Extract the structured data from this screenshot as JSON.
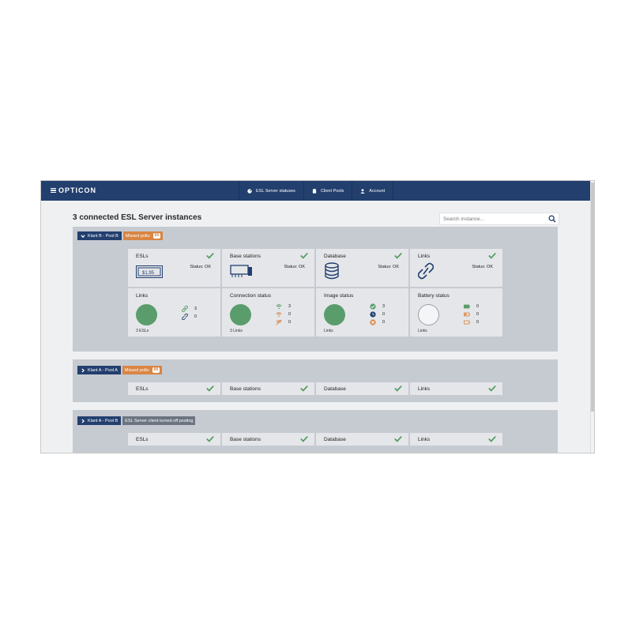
{
  "app": {
    "brand": "OPTICON",
    "nav": [
      {
        "label": "ESL Server statuses",
        "icon": "dashboard-icon"
      },
      {
        "label": "Client Pools",
        "icon": "clipboard-icon"
      },
      {
        "label": "Account",
        "icon": "user-icon"
      }
    ]
  },
  "page": {
    "title": "3 connected ESL Server instances",
    "search_placeholder": "Search instance..."
  },
  "colors": {
    "navy": "#223f6e",
    "orange": "#d98544",
    "green": "#5a9c6b",
    "check": "#4e9a5d",
    "panel": "#c6cad1"
  },
  "instances": [
    {
      "pool": "Klant B - Pool B",
      "badge_label": "Missed polls:",
      "badge_count": "89",
      "expanded": true,
      "cards": [
        {
          "title": "ESLs",
          "status": "Status: OK"
        },
        {
          "title": "Base stations",
          "status": "Status: OK"
        },
        {
          "title": "Database",
          "status": "Status: OK"
        },
        {
          "title": "Links",
          "status": "Status: OK"
        }
      ],
      "details": [
        {
          "title": "Links",
          "stats": [
            "3",
            "0"
          ],
          "footer": "3 ESLs"
        },
        {
          "title": "Connection status",
          "stats": [
            "3",
            "0",
            "0"
          ],
          "footer": "3 Links"
        },
        {
          "title": "Image status",
          "stats": [
            "3",
            "0",
            "0"
          ],
          "footer": "Links"
        },
        {
          "title": "Battery status",
          "stats": [
            "0",
            "0",
            "0"
          ],
          "footer": "Links"
        }
      ]
    },
    {
      "pool": "Klant A - Pool A",
      "badge_label": "Missed polls:",
      "badge_count": "89",
      "expanded": false,
      "cards": [
        {
          "title": "ESLs"
        },
        {
          "title": "Base stations"
        },
        {
          "title": "Database"
        },
        {
          "title": "Links"
        }
      ]
    },
    {
      "pool": "Klant A - Pool B",
      "badge_label": "ESL Server client turned off posting",
      "expanded": false,
      "cards": [
        {
          "title": "ESLs"
        },
        {
          "title": "Base stations"
        },
        {
          "title": "Database"
        },
        {
          "title": "Links"
        }
      ]
    }
  ]
}
